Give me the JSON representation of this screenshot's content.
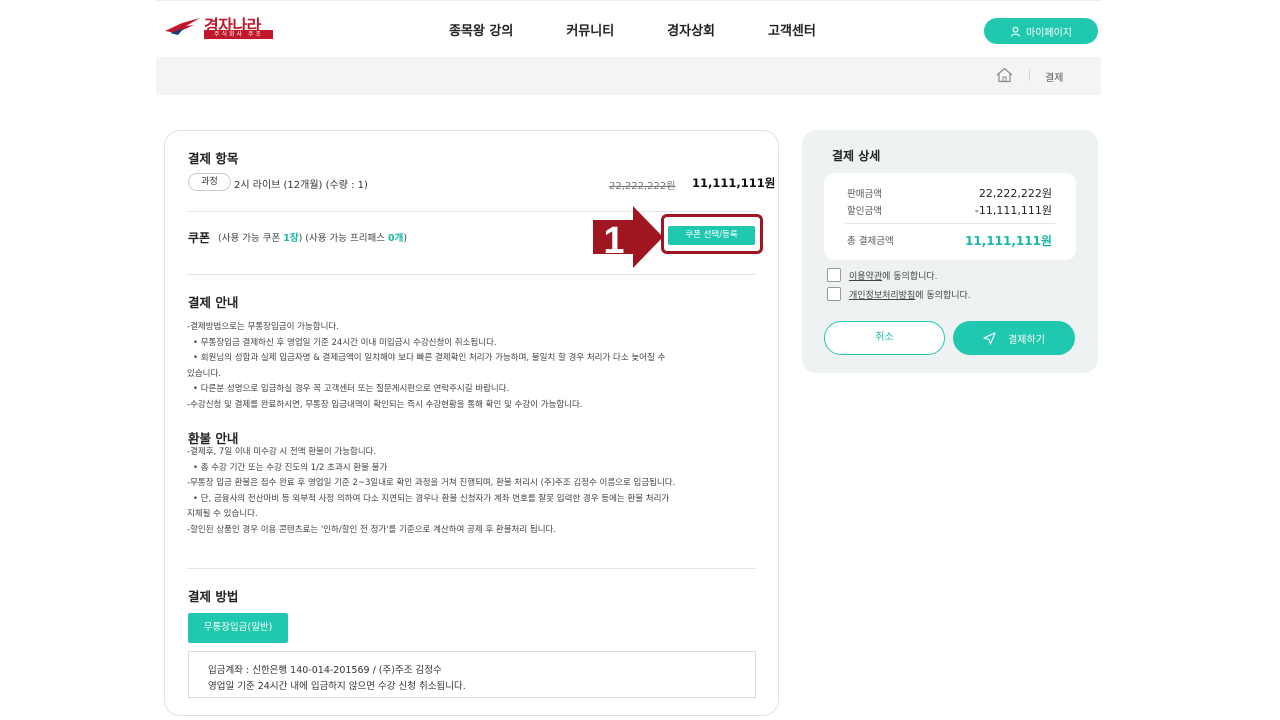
{
  "header": {
    "logo_text": "경자나라",
    "logo_sub": "주식회사 주조",
    "nav": [
      "종목왕 강의",
      "커뮤니티",
      "경자상회",
      "고객센터"
    ],
    "mypage_label": "마이페이지"
  },
  "breadcrumb": {
    "current": "결제"
  },
  "items": {
    "title": "결제 항목",
    "pill": "과정",
    "name": "2시 라이브 (12개월) (수량 : 1)",
    "orig_price": "22,222,222원",
    "sale_price": "11,111,111원"
  },
  "coupon": {
    "title": "쿠폰",
    "info_a": "(사용 가능 쿠폰 ",
    "count_a": "1장",
    "info_b": ") (사용 가능 프리패스 ",
    "count_b": "0개",
    "info_c": ")",
    "button": "쿠폰 선택/등록",
    "step_number": "1"
  },
  "guide": {
    "title": "결제 안내",
    "lines": [
      "-결제방법으로는 무통장입금이 가능합니다.",
      "• 무통장입금 결제하신 후 영업일 기준 24시간 이내 미입금시 수강신청이 취소됩니다.",
      "• 회원님의 성함과 실제 입금자명 & 결제금액이 일치해야 보다 빠른 결제확인 처리가 가능하며, 불일치 할 경우 처리가 다소 늦어질 수",
      "있습니다.",
      "• 다른분 성명으로 입금하실 경우 꼭 고객센터 또는 질문게시판으로 연락주시길 바랍니다.",
      "-수강신청 및 결제를 완료하시면, 무통장 입금내역이 확인되는 즉시 수강현황을 통해 확인 및 수강이 가능합니다."
    ]
  },
  "refund": {
    "title": "환불 안내",
    "lines": [
      "-결제후, 7일 이내 미수강 시 전액 환불이 가능합니다.",
      "• 총 수강 기간 또는 수강 진도의 1/2 초과시 환불 불가",
      "-무통장 입금 환불은 접수 완료 후 영업일 기준 2~3일내로 확인 과정을 거쳐 진행되며, 환불 처리시 (주)주조 김정수 이름으로 입금됩니다.",
      "• 단, 금융사의 전산마비 등 외부적 사정 의하여 다소 지연되는 경우나 환불 신청자가 계좌 번호를 잘못 입력한 경우 등에는 환불 처리가",
      "지체될 수 있습니다.",
      "-할인된 상품인 경우 이용 콘텐츠료는 '인하/할인 전 정가'를 기준으로 계산하여 공제 후 환불처리 됩니다."
    ]
  },
  "method": {
    "title": "결제 방법",
    "button": "무통장입금(일반)",
    "account": "입금계좌 : 신한은행 140-014-201569 / (주)주조 김정수",
    "notice": "영업일 기준 24시간 내에 입금하지 않으면 수강 신청 취소됩니다."
  },
  "detail": {
    "title": "결제 상세",
    "sale_label": "판매금액",
    "sale_value": "22,222,222원",
    "discount_label": "할인금액",
    "discount_value": "-11,111,111원",
    "total_label": "총 결제금액",
    "total_value": "11,111,111원",
    "agree_terms_link": "이용약관",
    "agree_terms_rest": "에 동의합니다.",
    "agree_privacy_link": "개인정보처리방침",
    "agree_privacy_rest": "에 동의합니다.",
    "cancel": "취소",
    "pay": "결제하기"
  },
  "colors": {
    "accent": "#20c8b0",
    "brand": "#c0182b",
    "highlight": "#a01620"
  }
}
